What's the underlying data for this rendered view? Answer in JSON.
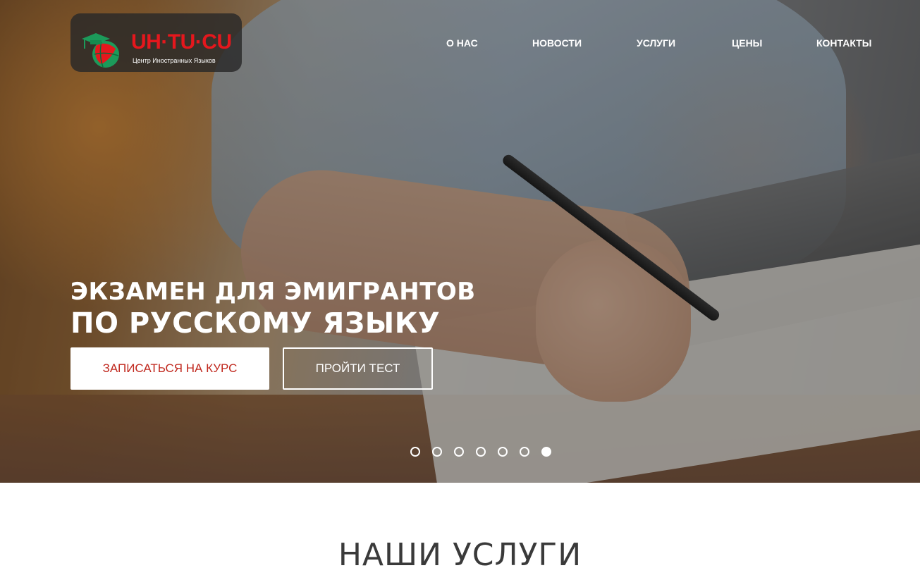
{
  "logo": {
    "brand": "UH·TU·CU",
    "tagline": "Центр Иностранных Языков"
  },
  "nav": {
    "items": [
      {
        "label": "О НАС"
      },
      {
        "label": "НОВОСТИ"
      },
      {
        "label": "УСЛУГИ"
      },
      {
        "label": "ЦЕНЫ"
      },
      {
        "label": "КОНТАКТЫ"
      }
    ]
  },
  "hero": {
    "headline_line1": "ЭКЗАМЕН ДЛЯ ЭМИГРАНТОВ",
    "headline_line2": "ПО РУССКОМУ ЯЗЫКУ",
    "primary_button": "ЗАПИСАТЬСЯ НА КУРС",
    "secondary_button": "ПРОЙТИ ТЕСТ",
    "slider": {
      "total_slides": 7,
      "active_slide": 7
    }
  },
  "services": {
    "title": "НАШИ УСЛУГИ"
  },
  "colors": {
    "brand_red": "#e5171d",
    "button_text_red": "#c0281e",
    "globe_green": "#1c9a5a",
    "text_white": "#ffffff",
    "heading_dark": "#3a3a3a"
  }
}
